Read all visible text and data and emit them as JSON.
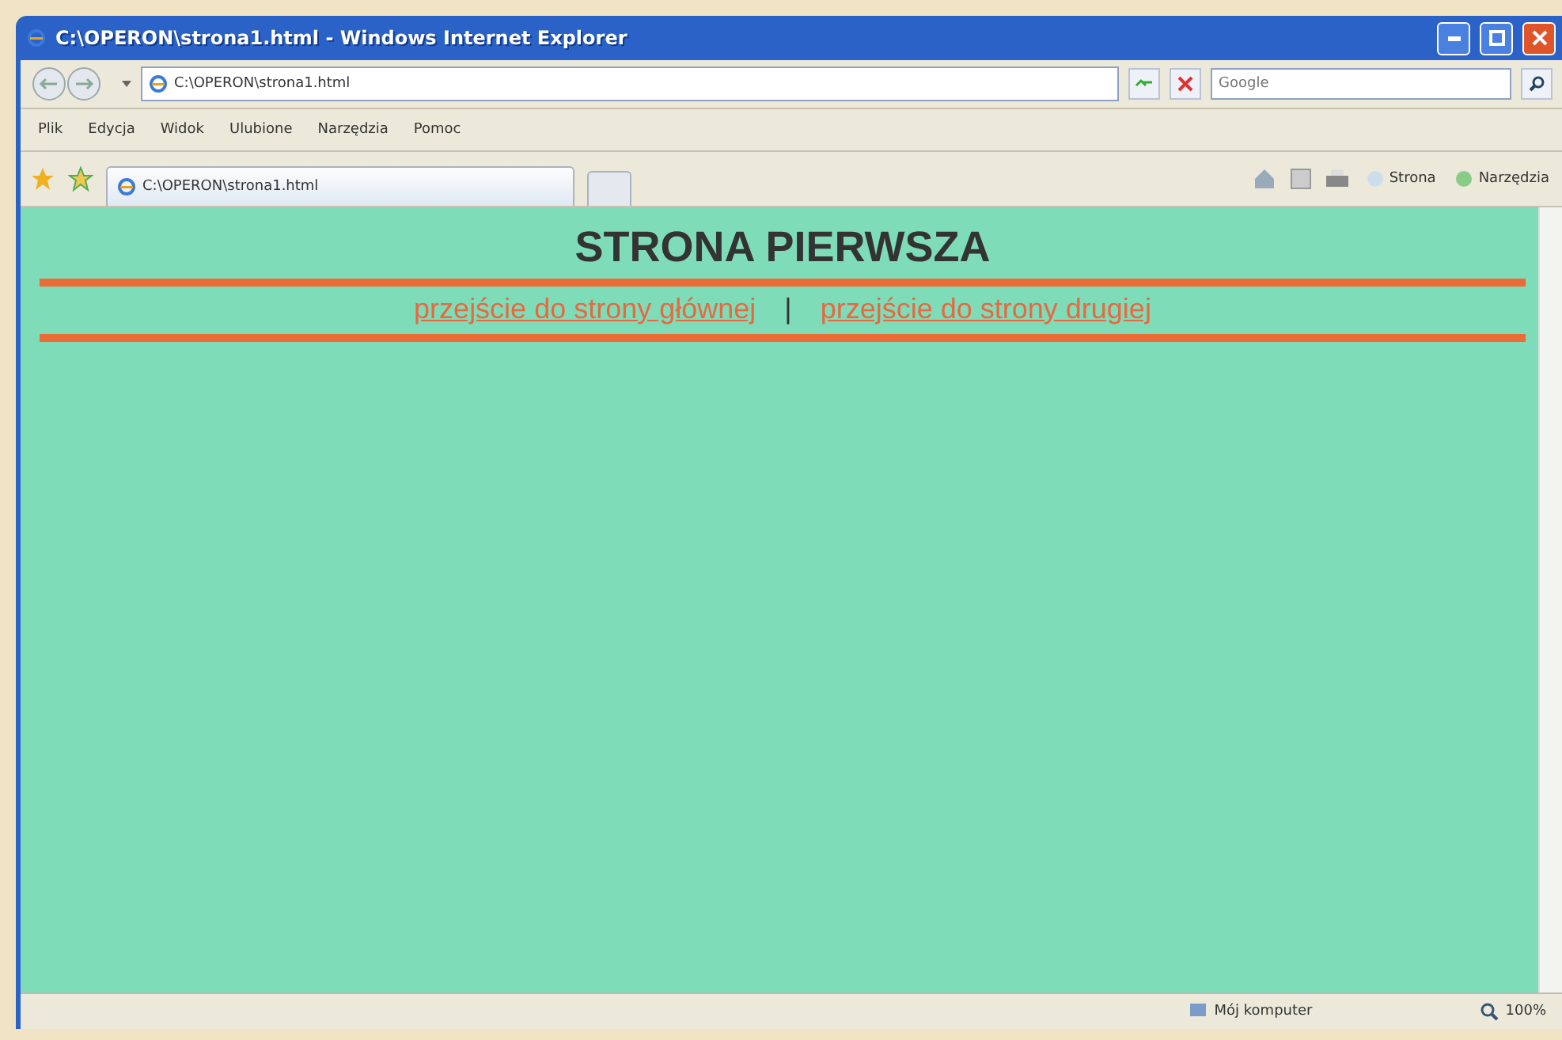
{
  "window": {
    "title": "C:\\OPERON\\strona1.html - Windows Internet Explorer"
  },
  "address": {
    "value": "C:\\OPERON\\strona1.html"
  },
  "search": {
    "placeholder": "Google"
  },
  "menu": [
    "Plik",
    "Edycja",
    "Widok",
    "Ulubione",
    "Narzędzia",
    "Pomoc"
  ],
  "tabs": [
    {
      "label": "C:\\OPERON\\strona1.html",
      "selected": true
    }
  ],
  "commands": [
    "Strona",
    "Narzędzia"
  ],
  "page": {
    "heading": "STRONA PIERWSZA",
    "links": [
      "przejście do strony głównej",
      "przejście do strony drugiej"
    ],
    "separator": "|"
  },
  "status_bar": {
    "zone": "Mój komputer",
    "zoom": "100%"
  }
}
